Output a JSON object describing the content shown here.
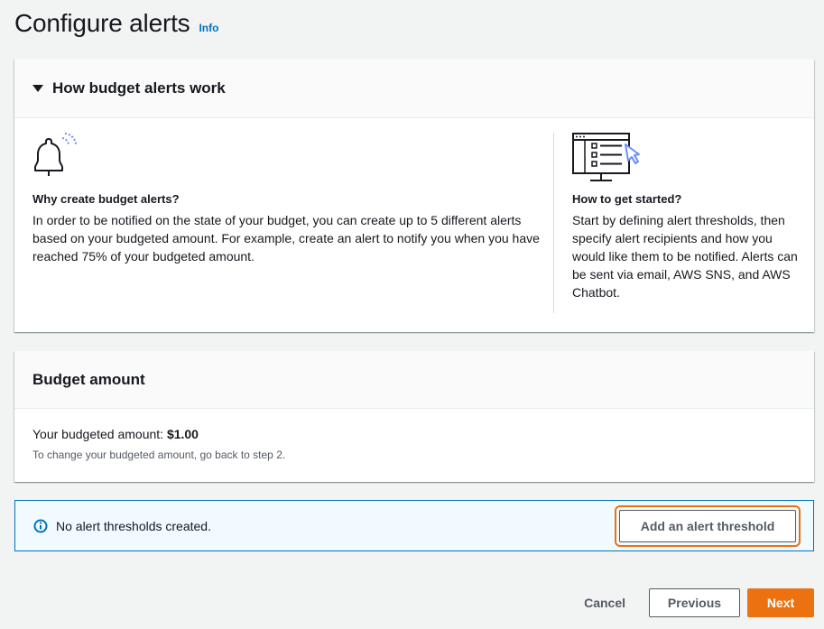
{
  "header": {
    "title": "Configure alerts",
    "info_label": "Info"
  },
  "how_it_works": {
    "title": "How budget alerts work",
    "left": {
      "icon": "bell-icon",
      "title": "Why create budget alerts?",
      "text": "In order to be notified on the state of your budget, you can create up to 5 different alerts based on your budgeted amount. For example, create an alert to notify you when you have reached 75% of your budgeted amount."
    },
    "right": {
      "icon": "monitor-checklist-icon",
      "title": "How to get started?",
      "text": "Start by defining alert thresholds, then specify alert recipients and how you would like them to be notified. Alerts can be sent via email, AWS SNS, and AWS Chatbot."
    }
  },
  "budget": {
    "title": "Budget amount",
    "amount_label": "Your budgeted amount:",
    "amount_value": "$1.00",
    "hint": "To change your budgeted amount, go back to step 2."
  },
  "alert_bar": {
    "icon": "info-icon",
    "message": "No alert thresholds created.",
    "button_label": "Add an alert threshold"
  },
  "footer": {
    "cancel_label": "Cancel",
    "previous_label": "Previous",
    "next_label": "Next"
  },
  "colors": {
    "accent_orange": "#ec7211",
    "link_blue": "#0073bb",
    "icon_blue": "#6b8cff"
  }
}
